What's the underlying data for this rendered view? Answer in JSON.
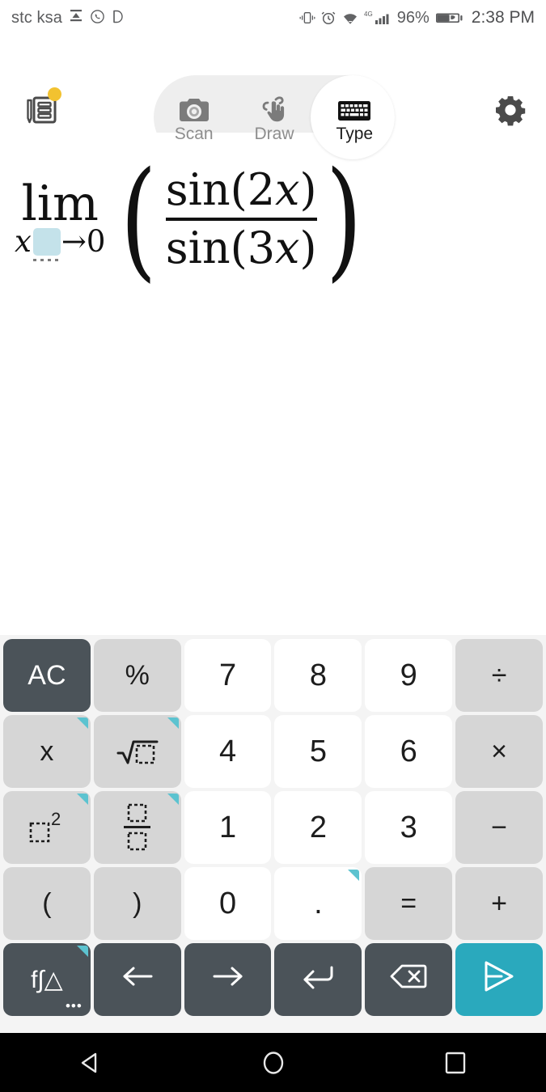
{
  "status_bar": {
    "carrier": "stc ksa",
    "left_icons": [
      "cast-icon",
      "whatsapp-icon",
      "do-not-disturb-icon"
    ],
    "right_icons": [
      "vibrate-icon",
      "alarm-icon",
      "wifi-icon",
      "signal-4g-icon",
      "battery-saver-icon"
    ],
    "network_type": "4G",
    "battery_percent": "96%",
    "time": "2:38 PM"
  },
  "toolbar": {
    "history_icon": "notebook-history-icon",
    "history_badge": true,
    "settings_icon": "gear-icon",
    "modes": [
      {
        "label": "Scan",
        "icon": "camera-icon",
        "active": false
      },
      {
        "label": "Draw",
        "icon": "hand-draw-icon",
        "active": false
      },
      {
        "label": "Type",
        "icon": "keyboard-icon",
        "active": true
      }
    ],
    "active_mode": "Type"
  },
  "expression": {
    "latex": "\\lim_{x\\to 0}\\left(\\frac{\\sin(2x)}{\\sin(3x)}\\right)",
    "limit_operator": "lim",
    "limit_variable": "x",
    "limit_arrow": "→",
    "limit_target": "0",
    "numerator": "sin(2x)",
    "denominator": "sin(3x)",
    "numerator_parts": {
      "fn": "sin(",
      "coef": "2",
      "var": "x",
      "close": ")"
    },
    "denominator_parts": {
      "fn": "sin(",
      "coef": "3",
      "var": "x",
      "close": ")"
    },
    "open_paren": "(",
    "close_paren": ")",
    "cursor_present": true,
    "cursor_color": "#c4e2ea"
  },
  "keypad": {
    "rows": [
      [
        {
          "name": "ac",
          "label": "AC",
          "style": "dark",
          "marker": false
        },
        {
          "name": "percent",
          "label": "%",
          "style": "func",
          "marker": false
        },
        {
          "name": "seven",
          "label": "7",
          "style": "num",
          "marker": false
        },
        {
          "name": "eight",
          "label": "8",
          "style": "num",
          "marker": false
        },
        {
          "name": "nine",
          "label": "9",
          "style": "num",
          "marker": false
        },
        {
          "name": "divide",
          "label": "÷",
          "style": "op",
          "marker": false
        }
      ],
      [
        {
          "name": "variable-x",
          "label": "x",
          "style": "func",
          "marker": true
        },
        {
          "name": "square-root",
          "label": "√□",
          "style": "func",
          "marker": true
        },
        {
          "name": "four",
          "label": "4",
          "style": "num",
          "marker": false
        },
        {
          "name": "five",
          "label": "5",
          "style": "num",
          "marker": false
        },
        {
          "name": "six",
          "label": "6",
          "style": "num",
          "marker": false
        },
        {
          "name": "multiply",
          "label": "×",
          "style": "op",
          "marker": false
        }
      ],
      [
        {
          "name": "power",
          "label": "□²",
          "style": "func",
          "marker": true
        },
        {
          "name": "fraction",
          "label": "□/□",
          "style": "func",
          "marker": true
        },
        {
          "name": "one",
          "label": "1",
          "style": "num",
          "marker": false
        },
        {
          "name": "two",
          "label": "2",
          "style": "num",
          "marker": false
        },
        {
          "name": "three",
          "label": "3",
          "style": "num",
          "marker": false
        },
        {
          "name": "minus",
          "label": "−",
          "style": "op",
          "marker": false
        }
      ],
      [
        {
          "name": "open-paren",
          "label": "(",
          "style": "func",
          "marker": false
        },
        {
          "name": "close-paren",
          "label": ")",
          "style": "func",
          "marker": false
        },
        {
          "name": "zero",
          "label": "0",
          "style": "num",
          "marker": false
        },
        {
          "name": "decimal-point",
          "label": ".",
          "style": "num",
          "marker": true
        },
        {
          "name": "equals",
          "label": "=",
          "style": "op",
          "marker": false
        },
        {
          "name": "plus",
          "label": "+",
          "style": "op",
          "marker": false
        }
      ],
      [
        {
          "name": "more-functions",
          "label": "f∫△",
          "style": "dark",
          "marker": true,
          "overflow": "•••"
        },
        {
          "name": "arrow-left",
          "label": "←",
          "style": "dark",
          "marker": false
        },
        {
          "name": "arrow-right",
          "label": "→",
          "style": "dark",
          "marker": false
        },
        {
          "name": "enter",
          "label": "↵",
          "style": "dark",
          "marker": false
        },
        {
          "name": "backspace",
          "label": "⌫",
          "style": "dark",
          "marker": false
        },
        {
          "name": "submit",
          "label": "➤",
          "style": "teal",
          "marker": false
        }
      ]
    ],
    "colors": {
      "background": "#f4f4f4",
      "key_light": "#d6d6d6",
      "key_num": "#ffffff",
      "key_dark": "#4b5359",
      "accent_teal": "#2aa9bd",
      "marker_teal": "#5cc3d0"
    }
  },
  "nav_bar": {
    "buttons": [
      {
        "name": "back",
        "icon": "triangle-back-icon"
      },
      {
        "name": "home",
        "icon": "circle-home-icon"
      },
      {
        "name": "recents",
        "icon": "square-recents-icon"
      }
    ]
  }
}
